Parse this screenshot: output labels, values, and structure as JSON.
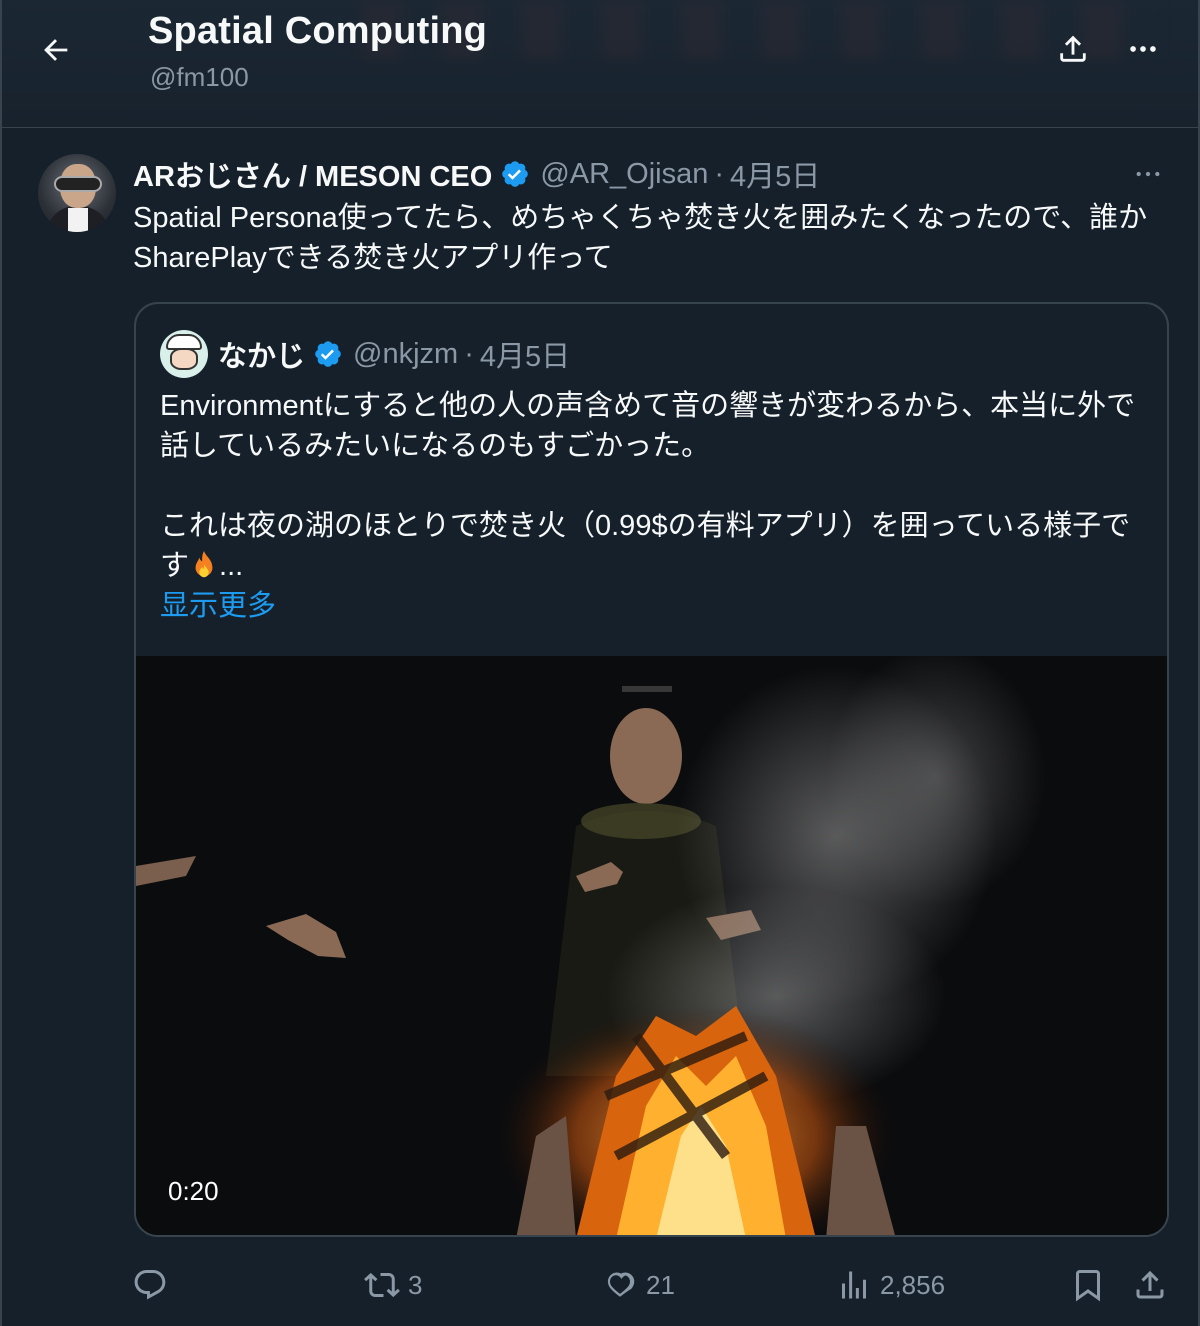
{
  "header": {
    "title": "Spatial Computing",
    "handle": "@fm100"
  },
  "tweet": {
    "author_name": "ARおじさん / MESON CEO",
    "handle": "@AR_Ojisan",
    "separator": "·",
    "date": "4月5日",
    "text": "Spatial Persona使ってたら、めちゃくちゃ焚き火を囲みたくなったので、誰かSharePlayできる焚き火アプリ作って"
  },
  "quote": {
    "author_name": "なかじ",
    "handle": "@nkjzm",
    "separator": "·",
    "date": "4月5日",
    "paragraph1": "Environmentにすると他の人の声含めて音の響きが変わるから、本当に外で話しているみたいになるのもすごかった。",
    "paragraph2": "これは夜の湖のほとりで焚き火（0.99$の有料アプリ）を囲っている様子です",
    "ellipsis": "...",
    "show_more": "显示更多",
    "video_duration": "0:20"
  },
  "actions": {
    "replies": "",
    "retweets": "3",
    "likes": "21",
    "views": "2,856"
  },
  "icons": {
    "back": "arrow-left-icon",
    "share": "share-icon",
    "more": "more-horizontal-icon",
    "verified": "verified-badge-icon",
    "reply": "reply-icon",
    "retweet": "retweet-icon",
    "like": "heart-icon",
    "views": "views-chart-icon",
    "bookmark": "bookmark-icon"
  },
  "colors": {
    "background": "#15202b",
    "text": "#f7f9f9",
    "muted": "#8b98a5",
    "accent": "#1d9bf0",
    "border": "#38444d"
  }
}
